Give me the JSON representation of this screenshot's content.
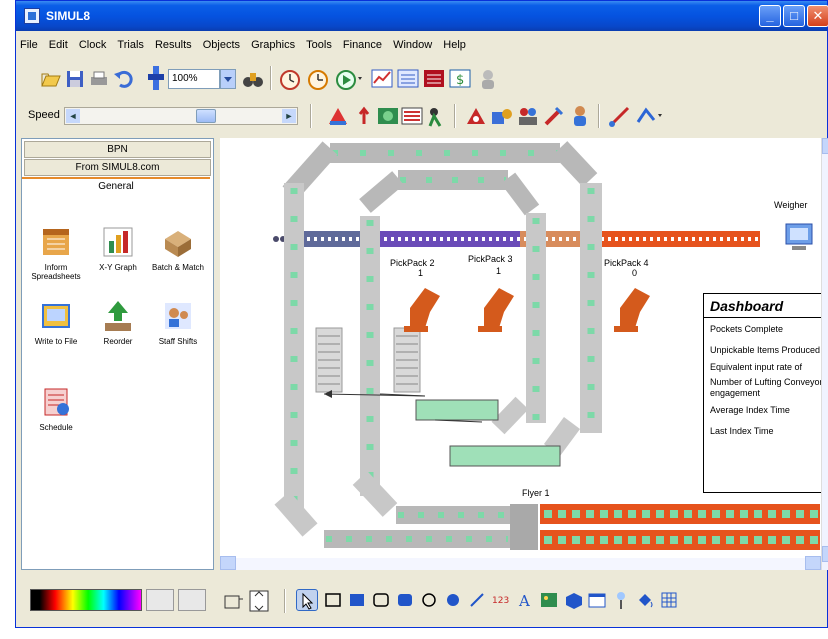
{
  "window": {
    "title": "SIMUL8",
    "controls": {
      "minimize": "_",
      "maximize": "□",
      "close": "✕"
    }
  },
  "menu": [
    "File",
    "Edit",
    "Clock",
    "Trials",
    "Results",
    "Objects",
    "Graphics",
    "Tools",
    "Finance",
    "Window",
    "Help"
  ],
  "toolbar": {
    "zoom_value": "100%",
    "speed_label": "Speed",
    "speed_level": 0.63
  },
  "left_panel": {
    "header1": "BPN",
    "header2": "From SIMUL8.com",
    "active_tab": "General",
    "tools": [
      {
        "label": "Inform Spreadsheets",
        "icon": "spreadsheet-icon"
      },
      {
        "label": "X-Y Graph",
        "icon": "graph-icon"
      },
      {
        "label": "Batch & Match",
        "icon": "batch-icon"
      },
      {
        "label": "Write to File",
        "icon": "write-file-icon"
      },
      {
        "label": "Reorder",
        "icon": "reorder-icon"
      },
      {
        "label": "Staff Shifts",
        "icon": "staff-shifts-icon"
      },
      {
        "label": "Schedule",
        "icon": "schedule-icon"
      }
    ]
  },
  "canvas": {
    "labels": {
      "weigher": "Weigher",
      "pickpack2": "PickPack 2",
      "pickpack2_count": "1",
      "pickpack3": "PickPack 3",
      "pickpack3_count": "1",
      "pickpack4": "PickPack 4",
      "pickpack4_count": "0",
      "flyer": "Flyer 1"
    },
    "dashboard": {
      "title": "Dashboard",
      "rows": [
        "Pockets Complete",
        "Unpickable Items Produced",
        "Equivalent input rate of",
        "Number of Lufting Conveyor engagement",
        "Average Index Time",
        "Last Index Time"
      ]
    }
  },
  "colors": {
    "title_bar": "#0553e0",
    "conveyor_gray": "#a9a9a9",
    "conveyor_green": "#7dd9a8",
    "item_purple": "#6a4bb8",
    "item_orange": "#e6531d",
    "robot_orange": "#d45a1c"
  }
}
